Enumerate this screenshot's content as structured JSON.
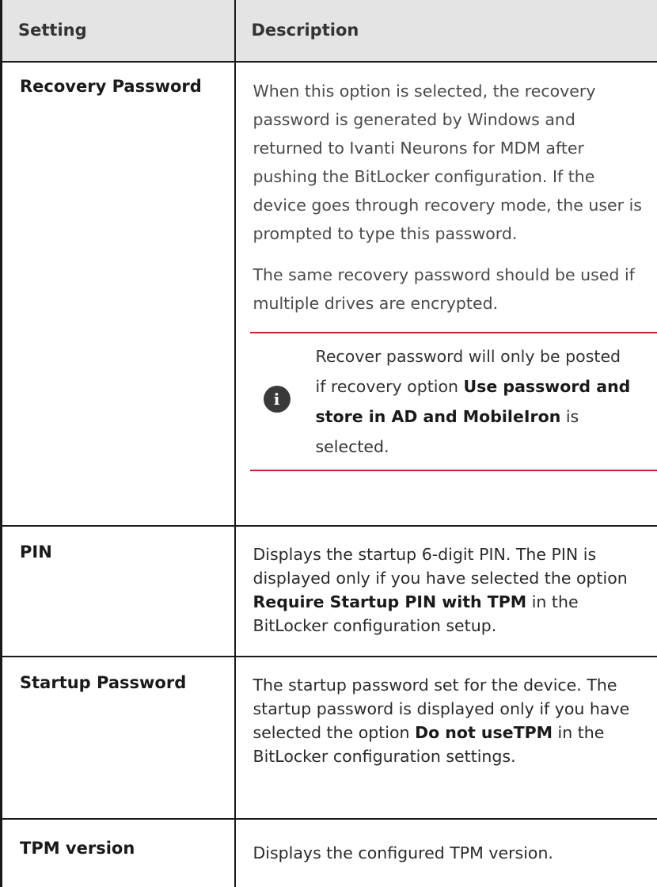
{
  "table": {
    "header": {
      "setting": "Setting",
      "description": "Description"
    },
    "rows": [
      {
        "setting": "Recovery Password",
        "paragraphs": [
          "When this option is selected, the recovery password is generated by Windows and returned to Ivanti Neurons for MDM after pushing the BitLocker configuration. If the device goes through recovery mode, the user is prompted to type this password.",
          "The same recovery password should be used if multiple drives are encrypted."
        ],
        "note": {
          "icon": "info-icon",
          "icon_glyph": "i",
          "accent_color": "#c8202c",
          "text_before": "Recover password will only be posted if recovery option ",
          "bold": "Use password and store in AD and MobileIron",
          "text_after": " is selected."
        }
      },
      {
        "setting": "PIN",
        "text_before": "Displays the startup 6-digit PIN. The PIN is displayed only if you have selected the option ",
        "bold": "Require Startup PIN with TPM",
        "text_after": " in the BitLocker configuration setup."
      },
      {
        "setting": "Startup Password",
        "text_before": "The startup password set for the device. The startup password is displayed only if you have selected the option ",
        "bold": "Do not useTPM",
        "text_after": " in the BitLocker configuration settings."
      },
      {
        "setting": "TPM version",
        "description": "Displays the configured TPM version."
      }
    ]
  }
}
